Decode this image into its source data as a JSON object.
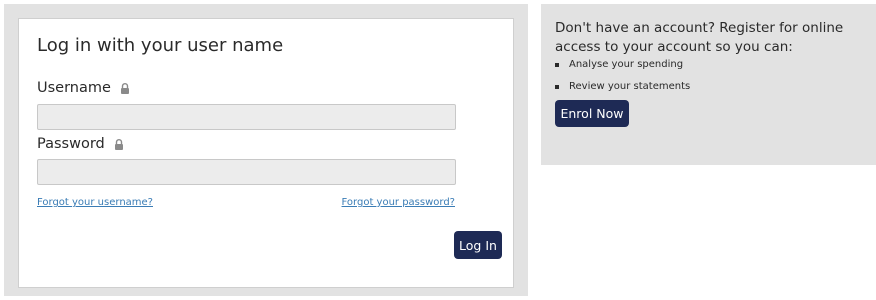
{
  "login": {
    "title": "Log in with your user name",
    "username_label": "Username",
    "password_label": "Password",
    "username_value": "",
    "password_value": "",
    "forgot_username": "Forgot your username?",
    "forgot_password": "Forgot your password?",
    "login_button": "Log In"
  },
  "register": {
    "heading": "Don't have an account? Register for online access to your account so you can:",
    "benefits": [
      "Analyse your spending",
      "Review your statements"
    ],
    "enrol_button": "Enrol Now"
  },
  "icons": {
    "lock": "lock-icon"
  },
  "colors": {
    "button_bg": "#1e2a55",
    "button_text": "#ffffff",
    "link": "#3a7cb5",
    "panel_bg": "#e2e2e2",
    "field_bg": "#ececec"
  }
}
